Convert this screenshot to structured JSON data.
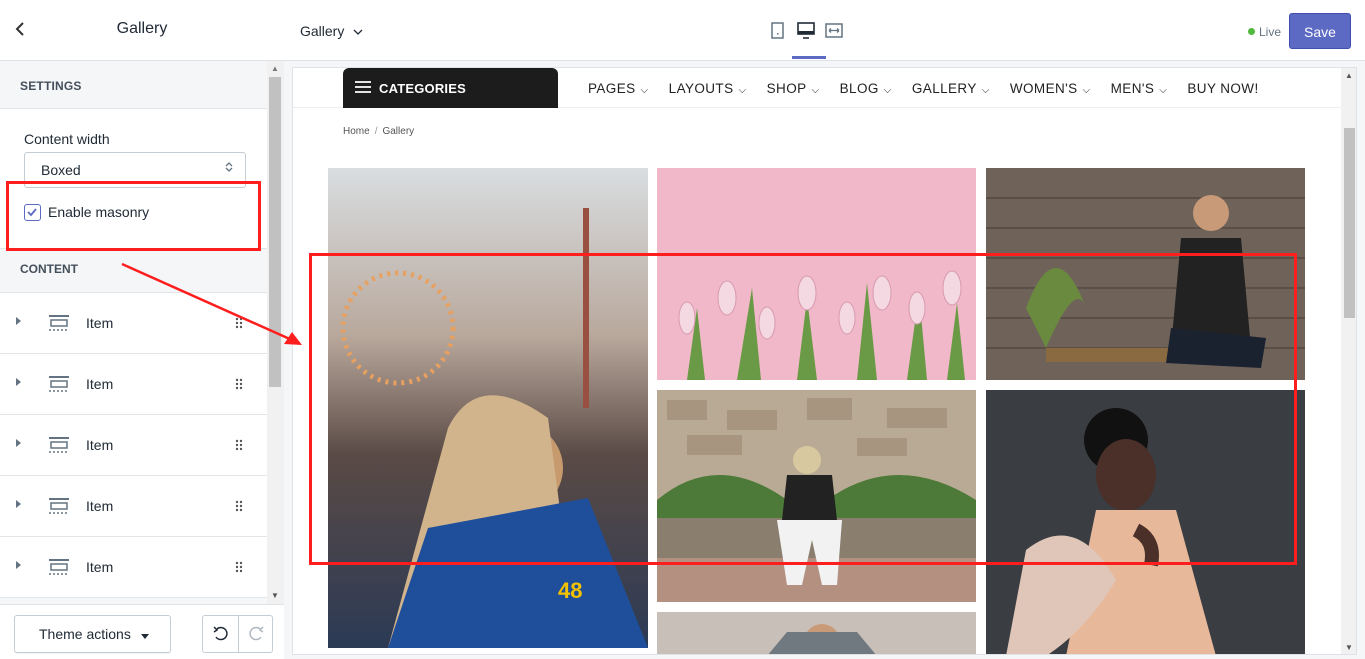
{
  "sidebar": {
    "title": "Gallery",
    "settings_heading": "SETTINGS",
    "content_width_label": "Content width",
    "content_width_value": "Boxed",
    "masonry_label": "Enable masonry",
    "masonry_checked": true,
    "content_heading": "CONTENT",
    "items": [
      {
        "label": "Item"
      },
      {
        "label": "Item"
      },
      {
        "label": "Item"
      },
      {
        "label": "Item"
      },
      {
        "label": "Item"
      }
    ],
    "theme_actions_label": "Theme actions"
  },
  "topbar": {
    "page_selector": "Gallery",
    "live_label": "Live",
    "save_label": "Save",
    "active_device": "desktop"
  },
  "preview": {
    "categories_label": "CATEGORIES",
    "menu": [
      {
        "label": "PAGES"
      },
      {
        "label": "LAYOUTS"
      },
      {
        "label": "SHOP"
      },
      {
        "label": "BLOG"
      },
      {
        "label": "GALLERY"
      },
      {
        "label": "WOMEN'S"
      },
      {
        "label": "MEN'S"
      },
      {
        "label": "BUY NOW!"
      }
    ],
    "breadcrumb": {
      "home": "Home",
      "separator": "/",
      "current": "Gallery"
    },
    "images": [
      {
        "name": "woman-at-carnival"
      },
      {
        "name": "pink-tulips"
      },
      {
        "name": "man-on-bench-wood-wall"
      },
      {
        "name": "man-on-stone-wall"
      },
      {
        "name": "woman-fur-coat"
      },
      {
        "name": "man-in-suit"
      }
    ]
  },
  "colors": {
    "accent": "#5c6ac4",
    "live_dot": "#50b83c",
    "annotation": "#ff1e1e",
    "nav_dark": "#1c1c1c"
  }
}
